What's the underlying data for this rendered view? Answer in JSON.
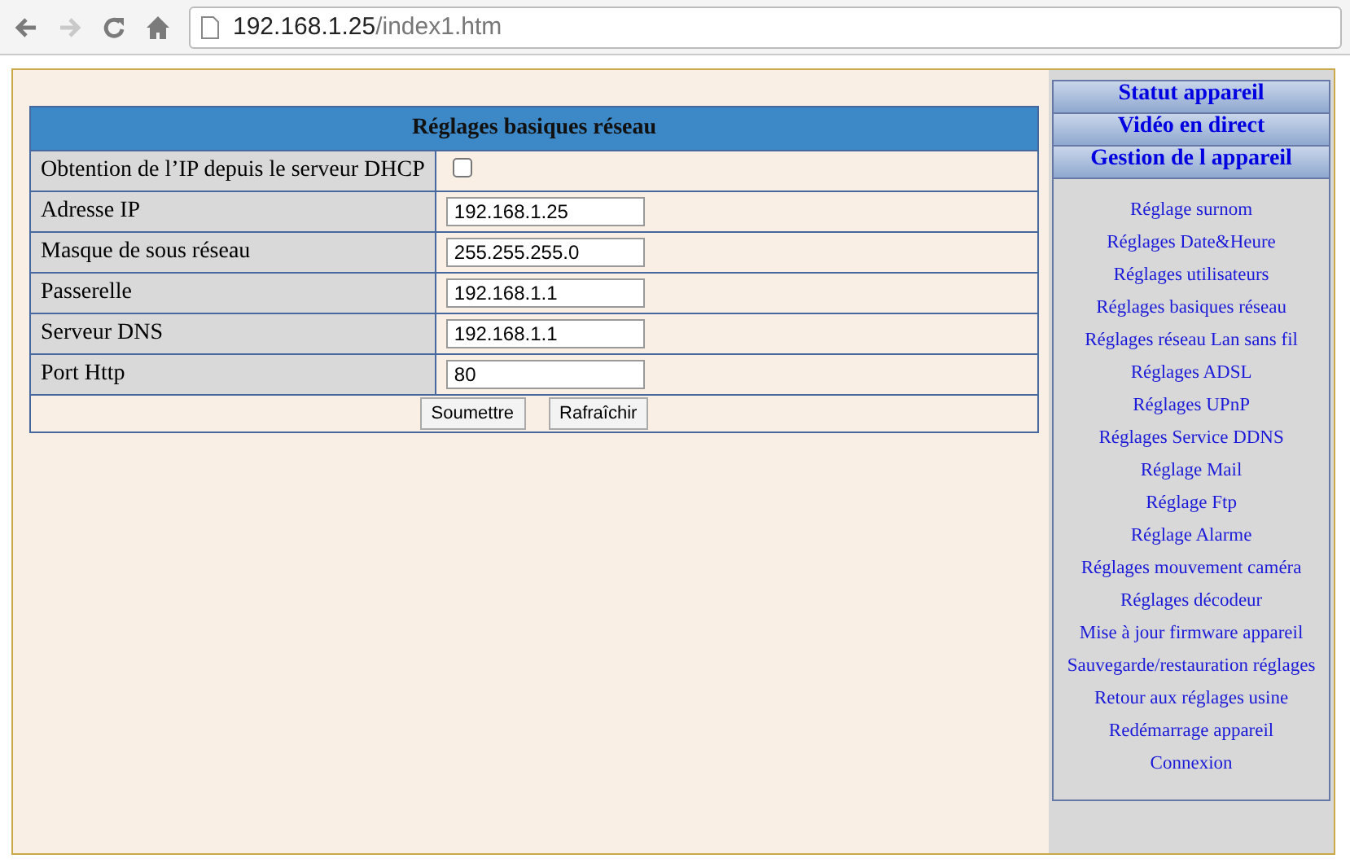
{
  "browser": {
    "back_disabled": false,
    "forward_disabled": true,
    "url_host": "192.168.1.25",
    "url_path": "/index1.htm"
  },
  "form": {
    "title": "Réglages basiques réseau",
    "rows": [
      {
        "kind": "checkbox",
        "label": "Obtention de l’IP depuis le serveur DHCP",
        "checked": false
      },
      {
        "kind": "text",
        "label": "Adresse IP",
        "value": "192.168.1.25"
      },
      {
        "kind": "text",
        "label": "Masque de sous réseau",
        "value": "255.255.255.0"
      },
      {
        "kind": "text",
        "label": "Passerelle",
        "value": "192.168.1.1"
      },
      {
        "kind": "text",
        "label": "Serveur DNS",
        "value": "192.168.1.1"
      },
      {
        "kind": "text",
        "label": "Port Http",
        "value": "80"
      }
    ],
    "buttons": [
      "Soumettre",
      "Rafraîchir"
    ]
  },
  "sidebar": {
    "sections": [
      "Statut appareil",
      "Vidéo en direct",
      "Gestion de l appareil"
    ],
    "items": [
      "Réglage surnom",
      "Réglages Date&Heure",
      "Réglages utilisateurs",
      "Réglages basiques réseau",
      "Réglages réseau Lan sans fil",
      "Réglages ADSL",
      "Réglages UPnP",
      "Réglages Service DDNS",
      "Réglage Mail",
      "Réglage Ftp",
      "Réglage Alarme",
      "Réglages mouvement caméra",
      "Réglages décodeur",
      "Mise à jour firmware appareil",
      "Sauvegarde/restauration réglages",
      "Retour aux réglages usine",
      "Redémarrage appareil",
      "Connexion"
    ]
  }
}
